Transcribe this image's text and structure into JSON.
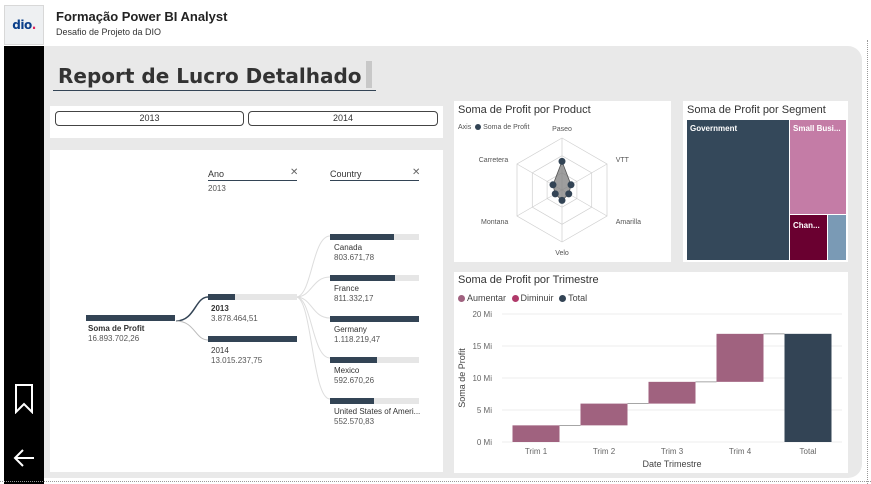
{
  "app": {
    "title": "Formação Power BI Analyst",
    "subtitle": "Desafio de Projeto da DIO",
    "logo_text": "dio."
  },
  "report": {
    "title": "Report de Lucro Detalhado"
  },
  "slicer": {
    "options": [
      "2013",
      "2014"
    ]
  },
  "decomposition": {
    "root": {
      "label": "Soma de Profit",
      "value": "16.893.702,26"
    },
    "level1": {
      "header": "Ano",
      "filter": "2013"
    },
    "level2": {
      "header": "Country"
    },
    "years": [
      {
        "label": "2013",
        "value": "3.878.464,51",
        "fill": 0.3
      },
      {
        "label": "2014",
        "value": "13.015.237,75",
        "fill": 1.0
      }
    ],
    "countries": [
      {
        "label": "Canada",
        "value": "803.671,78",
        "fill": 0.72
      },
      {
        "label": "France",
        "value": "811.332,17",
        "fill": 0.73
      },
      {
        "label": "Germany",
        "value": "1.118.219,47",
        "fill": 1.0
      },
      {
        "label": "Mexico",
        "value": "592.670,26",
        "fill": 0.53
      },
      {
        "label": "United States of Ameri...",
        "value": "552.570,83",
        "fill": 0.49
      }
    ]
  },
  "radar": {
    "title": "Soma de Profit por Product",
    "axis_label": "Axis",
    "legend_label": "Soma de Profit",
    "products": [
      "Paseo",
      "VTT",
      "Amarilla",
      "Velo",
      "Montana",
      "Carretera"
    ],
    "values": [
      0.55,
      0.2,
      0.15,
      0.2,
      0.15,
      0.2
    ]
  },
  "treemap": {
    "title": "Soma de Profit por Segment",
    "segments": [
      "Government",
      "Small Busi...",
      "Chan...",
      ""
    ]
  },
  "waterfall": {
    "title": "Soma de Profit por Trimestre",
    "legend": [
      "Aumentar",
      "Diminuir",
      "Total"
    ],
    "ylabel": "Soma de Profit",
    "xlabel": "Date Trimestre",
    "yticks": [
      "20 Mi",
      "15 Mi",
      "10 Mi",
      "5 Mi",
      "0 Mi"
    ]
  },
  "chart_data": {
    "type": "bar",
    "title": "Soma de Profit por Trimestre",
    "xlabel": "Date Trimestre",
    "ylabel": "Soma de Profit",
    "ylim": [
      0,
      20
    ],
    "categories": [
      "Trim 1",
      "Trim 2",
      "Trim 3",
      "Trim 4",
      "Total"
    ],
    "series": [
      {
        "name": "Aumentar",
        "values": [
          2.6,
          3.4,
          3.4,
          7.5,
          null
        ]
      },
      {
        "name": "Total",
        "values": [
          null,
          null,
          null,
          null,
          16.9
        ]
      }
    ],
    "start": [
      0,
      2.6,
      6.0,
      9.4,
      0
    ],
    "end": [
      2.6,
      6.0,
      9.4,
      16.9,
      16.9
    ]
  },
  "colors": {
    "dark": "#334455",
    "increase": "#a0627f",
    "decrease": "#b03a6a",
    "treemap_gov": "#34485a",
    "treemap_small": "#c47ca6",
    "treemap_chan": "#6a0030",
    "treemap_other": "#7a9ab5"
  }
}
